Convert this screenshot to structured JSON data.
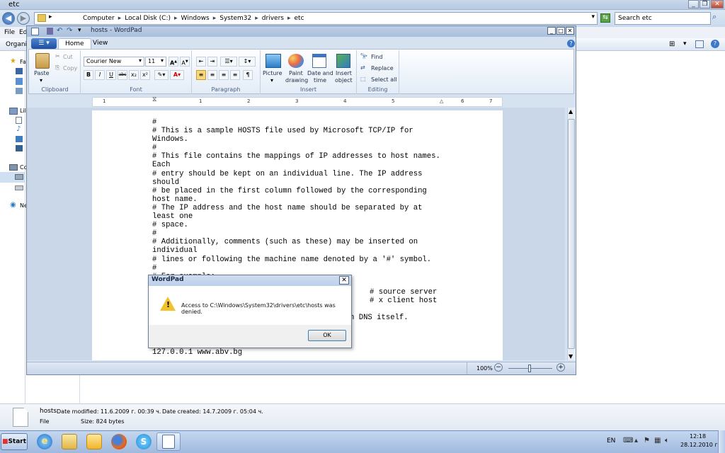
{
  "explorer": {
    "title": "etc",
    "breadcrumbs": [
      "Computer",
      "Local Disk (C:)",
      "Windows",
      "System32",
      "drivers",
      "etc"
    ],
    "search_placeholder": "Search etc",
    "menu": [
      "File",
      "Ed"
    ],
    "organize": "Organiz",
    "nav_items": [
      "Fa",
      "Lil",
      "Co",
      "Ne"
    ],
    "details": {
      "name": "hosts",
      "modified_label": "Date modified: 11.6.2009 г. 00:39 ч.",
      "created_label": "Date created: 14.7.2009 г. 05:04 ч.",
      "type": "File",
      "size_label": "Size: 824 bytes"
    }
  },
  "taskbar": {
    "start": "Start",
    "lang": "EN",
    "time": "12:18",
    "date": "28.12.2010 г."
  },
  "wordpad": {
    "title": "hosts - WordPad",
    "tabs": [
      "Home",
      "View"
    ],
    "clipboard": {
      "paste": "Paste",
      "cut": "Cut",
      "copy": "Copy",
      "label": "Clipboard"
    },
    "font": {
      "family": "Courier New",
      "size": "11",
      "label": "Font",
      "bold": "B",
      "italic": "I",
      "underline": "U",
      "strike": "abc",
      "sub": "x₂",
      "sup": "x²"
    },
    "paragraph": {
      "label": "Paragraph"
    },
    "insert": {
      "picture": "Picture",
      "paint_1": "Paint",
      "paint_2": "drawing",
      "date_1": "Date and",
      "date_2": "time",
      "object_1": "Insert",
      "object_2": "object",
      "label": "Insert"
    },
    "editing": {
      "find": "Find",
      "replace": "Replace",
      "select_all": "Select all",
      "label": "Editing"
    },
    "ruler_marks": [
      "1",
      "1",
      "2",
      "3",
      "4",
      "5",
      "6",
      "7"
    ],
    "document_text": "#\n# This is a sample HOSTS file used by Microsoft TCP/IP for\nWindows.\n#\n# This file contains the mappings of IP addresses to host names.\nEach\n# entry should be kept on an individual line. The IP address\nshould\n# be placed in the first column followed by the corresponding\nhost name.\n# The IP address and the host name should be separated by at\nleast one\n# space.\n#\n# Additionally, comments (such as these) may be inserted on\nindividual\n# lines or following the machine name denoted by a '#' symbol.\n#\n# For example:",
    "doc_right_1": "# source server",
    "doc_right_2": "# x client host",
    "doc_right_3": "n DNS itself.",
    "doc_last_line": "127.0.0.1 www.abv.bg",
    "zoom": "100%"
  },
  "dialog": {
    "title": "WordPad",
    "message": "Access to C:\\Windows\\System32\\drivers\\etc\\hosts was denied.",
    "ok": "OK"
  }
}
